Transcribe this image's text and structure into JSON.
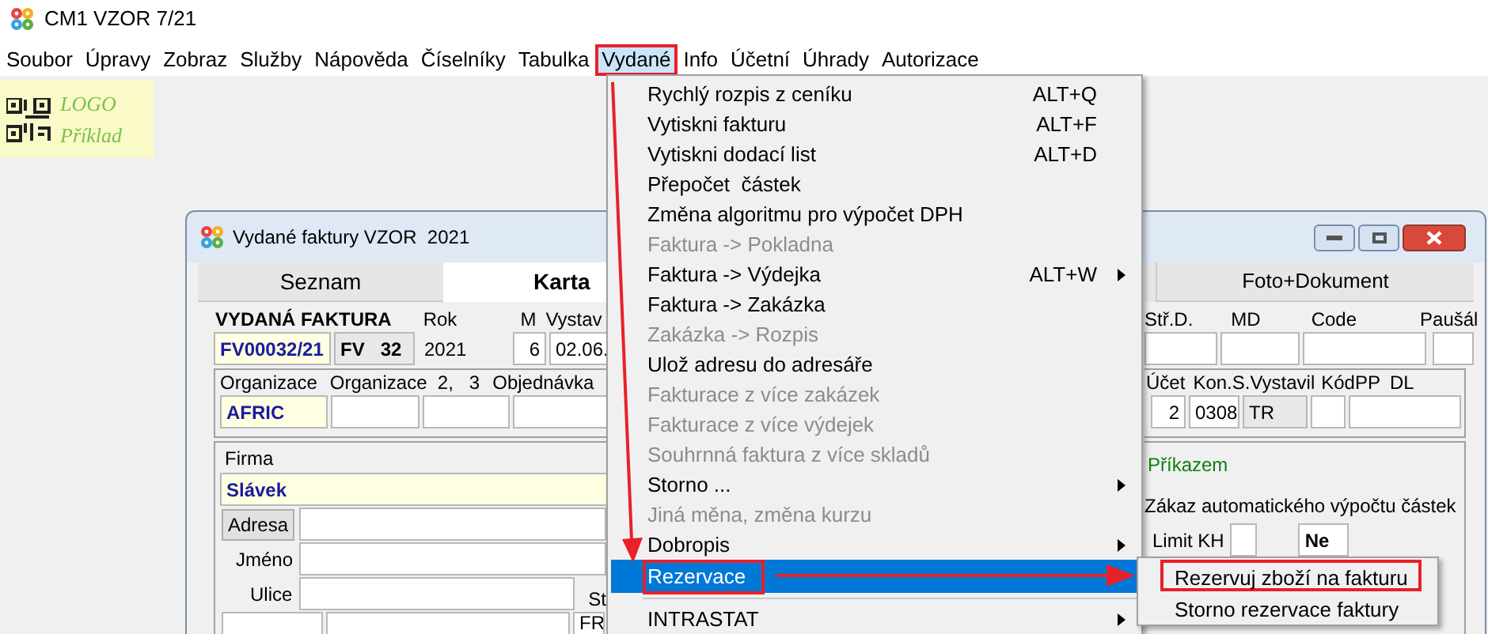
{
  "window": {
    "title": "CM1 VZOR 7/21"
  },
  "menubar": [
    {
      "label": "Soubor",
      "selected": false,
      "annotated": false
    },
    {
      "label": "Úpravy",
      "selected": false,
      "annotated": false
    },
    {
      "label": "Zobraz",
      "selected": false,
      "annotated": false
    },
    {
      "label": "Služby",
      "selected": false,
      "annotated": false
    },
    {
      "label": "Nápověda",
      "selected": false,
      "annotated": false
    },
    {
      "label": "Číselníky",
      "selected": false,
      "annotated": false
    },
    {
      "label": "Tabulka",
      "selected": false,
      "annotated": false
    },
    {
      "label": "Vydané",
      "selected": true,
      "annotated": true
    },
    {
      "label": "Info",
      "selected": false,
      "annotated": false
    },
    {
      "label": "Účetní",
      "selected": false,
      "annotated": false
    },
    {
      "label": "Úhrady",
      "selected": false,
      "annotated": false
    },
    {
      "label": "Autorizace",
      "selected": false,
      "annotated": false
    }
  ],
  "logo": {
    "line_1": "LOGO",
    "line_2": "Příklad"
  },
  "child_window": {
    "title": "Vydané faktury VZOR  2021",
    "tabs": [
      {
        "label": "Seznam",
        "selected": false
      },
      {
        "label": "Karta",
        "selected": true
      },
      {
        "label": "Foto+Dokument",
        "selected": false
      }
    ],
    "left": {
      "heading": "VYDANÁ FAKTURA",
      "labels": [
        "Rok",
        "M",
        "Vystav"
      ],
      "fields": [
        {
          "value": "FV00032/21",
          "kind": "key"
        },
        {
          "value": "FV   32",
          "kind": "locked",
          "bold": true
        },
        {
          "value": "2021",
          "kind": "text"
        },
        {
          "value": "6",
          "kind": "input"
        },
        {
          "value": "02.06.",
          "kind": "input"
        }
      ],
      "org_labels": [
        "Organizace",
        "Organizace  2,",
        "3",
        "Objednávka"
      ],
      "org_fields": [
        {
          "value": "AFRIC",
          "kind": "key"
        },
        {
          "kind": "input"
        },
        {
          "kind": "input"
        },
        {
          "kind": "input"
        }
      ],
      "firma_label": "Firma",
      "firma": {
        "value": "Slávek",
        "kind": "key"
      },
      "address_button": "Adresa",
      "name_label": "Jméno",
      "street_label": "Ulice",
      "state_label": "St",
      "last_row": [
        {
          "kind": "input"
        },
        {
          "kind": "input"
        },
        {
          "value": "FR",
          "kind": "input"
        }
      ]
    },
    "right": {
      "labels": [
        "Stř.D.",
        "MD",
        "Code",
        "Paušál"
      ],
      "fields": [
        {
          "kind": "input"
        },
        {
          "kind": "input"
        },
        {
          "kind": "input"
        },
        {
          "kind": "input"
        }
      ],
      "account_labels": [
        "Účet",
        "Kon.S.",
        "Vystavil",
        "KódPP",
        "DL"
      ],
      "account_fields": [
        {
          "value": "2",
          "kind": "input"
        },
        {
          "value": "0308",
          "kind": "input"
        },
        {
          "value": "TR",
          "kind": "locked",
          "bold": false
        },
        {
          "kind": "input"
        },
        {
          "kind": "input"
        }
      ],
      "payment": "Příkazem",
      "auto_calc": "Zákaz automatického výpočtu částek",
      "limit_label": "Limit KH",
      "limit_fields": [
        {
          "kind": "input"
        },
        {
          "value": "Ne",
          "kind": "input",
          "bold": true
        }
      ]
    }
  },
  "dropdown": {
    "items": [
      {
        "kind": "item",
        "label": "Rychlý rozpis z ceníku",
        "shortcut": "ALT+Q",
        "disabled": false,
        "submenu": false,
        "selected": false,
        "annotated": false
      },
      {
        "kind": "item",
        "label": "Vytiskni fakturu",
        "shortcut": "ALT+F",
        "disabled": false,
        "submenu": false,
        "selected": false,
        "annotated": false
      },
      {
        "kind": "item",
        "label": "Vytiskni dodací list",
        "shortcut": "ALT+D",
        "disabled": false,
        "submenu": false,
        "selected": false,
        "annotated": false
      },
      {
        "kind": "item",
        "label": "Přepočet  částek",
        "disabled": false,
        "submenu": false,
        "selected": false,
        "annotated": false
      },
      {
        "kind": "item",
        "label": "Změna algoritmu pro výpočet DPH",
        "disabled": false,
        "submenu": false,
        "selected": false,
        "annotated": false
      },
      {
        "kind": "item",
        "label": "Faktura -> Pokladna",
        "disabled": true,
        "submenu": false,
        "selected": false,
        "annotated": false
      },
      {
        "kind": "item",
        "label": "Faktura -> Výdejka",
        "shortcut": "ALT+W",
        "disabled": false,
        "submenu": true,
        "selected": false,
        "annotated": false
      },
      {
        "kind": "item",
        "label": "Faktura -> Zakázka",
        "disabled": false,
        "submenu": false,
        "selected": false,
        "annotated": false
      },
      {
        "kind": "item",
        "label": "Zakázka -> Rozpis",
        "disabled": true,
        "submenu": false,
        "selected": false,
        "annotated": false
      },
      {
        "kind": "item",
        "label": "Ulož adresu do adresáře",
        "disabled": false,
        "submenu": false,
        "selected": false,
        "annotated": false
      },
      {
        "kind": "item",
        "label": "Fakturace z více zakázek",
        "disabled": true,
        "submenu": false,
        "selected": false,
        "annotated": false
      },
      {
        "kind": "item",
        "label": "Fakturace z více výdejek",
        "disabled": true,
        "submenu": false,
        "selected": false,
        "annotated": false
      },
      {
        "kind": "item",
        "label": "Souhrnná faktura z více skladů",
        "disabled": true,
        "submenu": false,
        "selected": false,
        "annotated": false
      },
      {
        "kind": "item",
        "label": "Storno ...",
        "disabled": false,
        "submenu": true,
        "selected": false,
        "annotated": false
      },
      {
        "kind": "item",
        "label": "Jiná měna, změna kurzu",
        "disabled": true,
        "submenu": false,
        "selected": false,
        "annotated": false
      },
      {
        "kind": "item",
        "label": "Dobropis",
        "disabled": false,
        "submenu": true,
        "selected": false,
        "annotated": false
      },
      {
        "kind": "item",
        "label": "Rezervace",
        "disabled": false,
        "submenu": false,
        "selected": true,
        "annotated": true
      },
      {
        "kind": "separator"
      },
      {
        "kind": "item",
        "label": "INTRASTAT",
        "disabled": false,
        "submenu": true,
        "selected": false,
        "annotated": false
      }
    ]
  },
  "submenu": {
    "items": [
      {
        "label": "Rezervuj zboží na fakturu",
        "annotated": true
      },
      {
        "label": "Storno rezervace faktury",
        "annotated": false
      }
    ]
  }
}
